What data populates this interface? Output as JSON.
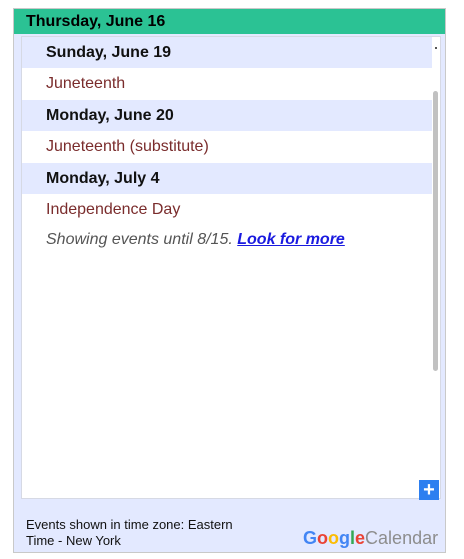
{
  "header": {
    "title": "Thursday, June 16",
    "background": "#2bc294"
  },
  "events": [
    {
      "date": "Sunday, June 19",
      "title": "Juneteenth"
    },
    {
      "date": "Monday, June 20",
      "title": "Juneteenth (substitute)"
    },
    {
      "date": "Monday, July 4",
      "title": "Independence Day"
    }
  ],
  "note": {
    "text": "Showing events until 8/15.",
    "link": "Look for more"
  },
  "footer": {
    "timezone_line1": "Events shown in time zone: Eastern",
    "timezone_line2": "Time - New York",
    "add_button_symbol": "+",
    "logo_letters": [
      "G",
      "o",
      "o",
      "g",
      "l",
      "e"
    ],
    "logo_suffix": "Calendar"
  },
  "colors": {
    "accent": "#2bc294",
    "date_row_bg": "#e3e9ff",
    "event_text": "#7a2c2c",
    "link": "#1a1adf",
    "add_button": "#2d7ff0"
  },
  "icons": {
    "add": "plus-icon",
    "scroll": "scrollbar"
  }
}
